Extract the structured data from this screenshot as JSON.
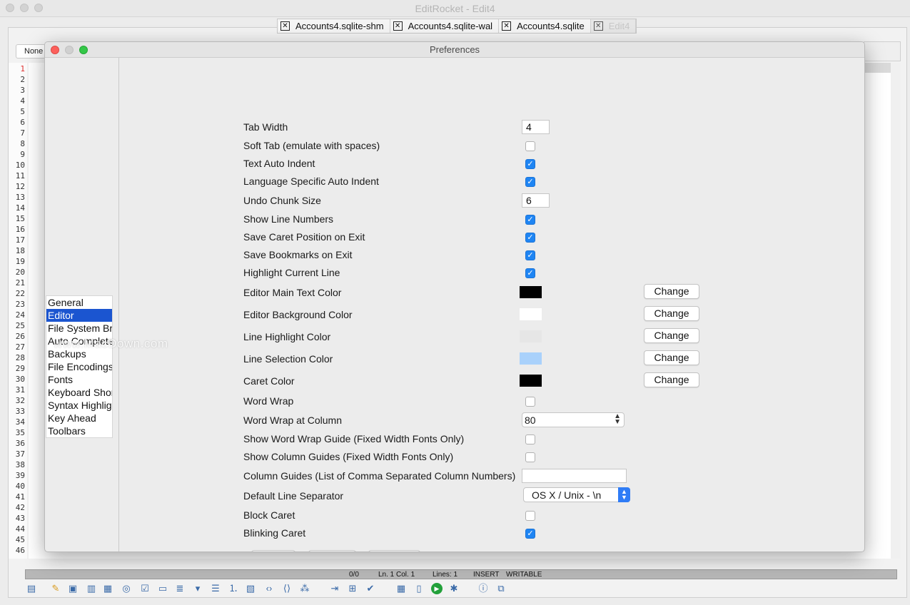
{
  "app": {
    "window_title": "EditRocket - Edit4",
    "tabs": [
      {
        "label": "Accounts4.sqlite-shm",
        "close": "✕"
      },
      {
        "label": "Accounts4.sqlite-wal",
        "close": "✕"
      },
      {
        "label": "Accounts4.sqlite",
        "close": "✕"
      },
      {
        "label": "Edit4",
        "close": "✕"
      }
    ],
    "syntax_select": "None",
    "line_numbers": [
      "1",
      "2",
      "3",
      "4",
      "5",
      "6",
      "7",
      "8",
      "9",
      "10",
      "11",
      "12",
      "13",
      "14",
      "15",
      "16",
      "17",
      "18",
      "19",
      "20",
      "21",
      "22",
      "23",
      "24",
      "25",
      "26",
      "27",
      "28",
      "29",
      "30",
      "31",
      "32",
      "33",
      "34",
      "35",
      "36",
      "37",
      "38",
      "39",
      "40",
      "41",
      "42",
      "43",
      "44",
      "45",
      "46"
    ],
    "status": {
      "selection": "0/0",
      "position": "Ln. 1 Col. 1",
      "lines": "Lines: 1",
      "mode": "INSERT",
      "access": "WRITABLE"
    },
    "bottom_toolbar_icons": [
      "table-icon",
      "pencil-icon",
      "image-icon",
      "layout-icon",
      "columns-icon",
      "radio-icon",
      "checkbox-icon",
      "ok-button-icon",
      "text-block-icon",
      "dropdown-icon",
      "list-icon",
      "list-numbered-icon",
      "form-icon",
      "code-tag-icon",
      "code-alt-icon",
      "circles-icon",
      "insert-icon",
      "tree-icon",
      "checklist-icon",
      "grid-icon",
      "binary-icon",
      "run-icon",
      "bug-icon",
      "info-icon",
      "plugin-icon"
    ]
  },
  "dialog": {
    "title": "Preferences",
    "categories": [
      "General",
      "Editor",
      "File System Browser",
      "Auto Complete",
      "Backups",
      "File Encodings",
      "Fonts",
      "Keyboard Shortcuts",
      "Syntax Highlighting",
      "Key Ahead",
      "Toolbars"
    ],
    "selected_category": "Editor",
    "watermark": "www.MacDown.com",
    "settings": {
      "tab_width": {
        "label": "Tab Width",
        "value": "4"
      },
      "soft_tab": {
        "label": "Soft Tab (emulate with spaces)",
        "checked": false
      },
      "text_auto_indent": {
        "label": "Text Auto Indent",
        "checked": true
      },
      "lang_auto_indent": {
        "label": "Language Specific Auto Indent",
        "checked": true
      },
      "undo_chunk": {
        "label": "Undo Chunk Size",
        "value": "6"
      },
      "show_line_numbers": {
        "label": "Show Line Numbers",
        "checked": true
      },
      "save_caret": {
        "label": "Save Caret Position on Exit",
        "checked": true
      },
      "save_bookmarks": {
        "label": "Save Bookmarks on Exit",
        "checked": true
      },
      "highlight_line": {
        "label": "Highlight Current Line",
        "checked": true
      },
      "main_text_color": {
        "label": "Editor Main Text Color",
        "color": "#000000",
        "button": "Change"
      },
      "background_color": {
        "label": "Editor Background Color",
        "color": "#ffffff",
        "button": "Change"
      },
      "line_highlight_color": {
        "label": "Line Highlight Color",
        "color": "#e6e6e6",
        "button": "Change"
      },
      "line_selection_color": {
        "label": "Line Selection Color",
        "color": "#a9d1fb",
        "button": "Change"
      },
      "caret_color": {
        "label": "Caret Color",
        "color": "#000000",
        "button": "Change"
      },
      "word_wrap": {
        "label": "Word Wrap",
        "checked": false
      },
      "word_wrap_column": {
        "label": "Word Wrap at Column",
        "value": "80"
      },
      "word_wrap_guide": {
        "label": "Show Word Wrap Guide (Fixed Width Fonts Only)",
        "checked": false
      },
      "column_guides": {
        "label": "Show Column Guides (Fixed Width Fonts Only)",
        "checked": false
      },
      "column_guides_list": {
        "label": "Column Guides (List of Comma Separated Column Numbers)",
        "value": ""
      },
      "line_separator": {
        "label": "Default Line Separator",
        "value": "OS X / Unix - \\n"
      },
      "block_caret": {
        "label": "Block Caret",
        "checked": false
      },
      "blinking_caret": {
        "label": "Blinking Caret",
        "checked": true
      }
    },
    "checkmark": "✓"
  }
}
